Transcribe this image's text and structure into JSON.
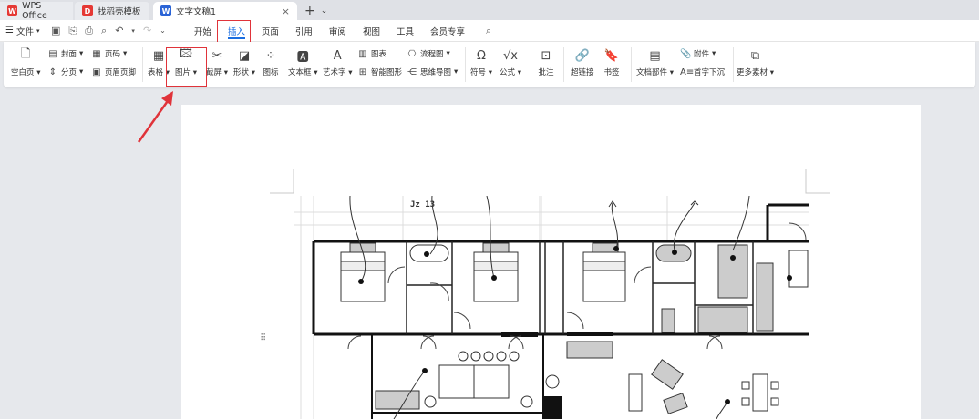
{
  "tabs": {
    "wps": "WPS Office",
    "template": "找稻壳模板",
    "doc": "文字文稿1",
    "close": "×",
    "plus": "+",
    "more": "⌄"
  },
  "menu": {
    "file": "文件",
    "tabs": [
      "开始",
      "插入",
      "页面",
      "引用",
      "审阅",
      "视图",
      "工具",
      "会员专享"
    ],
    "active_index": 1
  },
  "ribbon": {
    "blank_page": "空白页",
    "cover": "封面",
    "page_break": "分页",
    "page_num": "页码",
    "header_footer": "页眉页脚",
    "table": "表格",
    "picture": "图片",
    "screenshot": "截屏",
    "shape": "形状",
    "icon": "图标",
    "textbox": "文本框",
    "wordart": "艺术字",
    "chart": "图表",
    "smartart": "智能图形",
    "flowchart": "流程图",
    "mindmap": "思维导图",
    "symbol": "符号",
    "formula": "公式",
    "comment": "批注",
    "hyperlink": "超链接",
    "bookmark": "书签",
    "doc_parts": "文档部件",
    "attachment": "附件",
    "dropcap": "首字下沉",
    "more_material": "更多素材"
  },
  "floorplan_label": "Jz 13",
  "colors": {
    "accent": "#1a6de0",
    "highlight": "#e0333a"
  }
}
